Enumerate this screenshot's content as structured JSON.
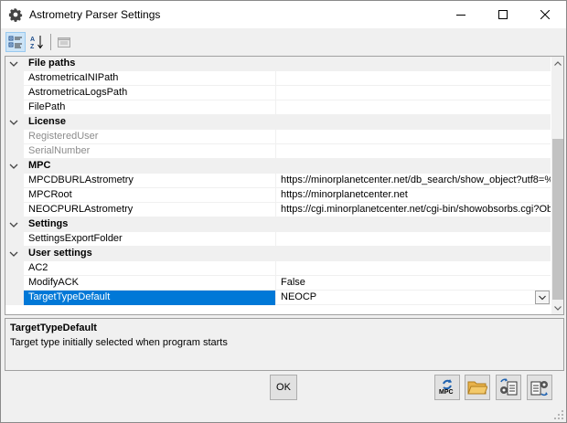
{
  "window": {
    "title": "Astrometry Parser Settings",
    "icon": "gear-icon"
  },
  "toolbar": {
    "categorized_icon": "categorized-view-icon",
    "alphabetical_icon": "sort-az-icon",
    "property_pages_icon": "property-pages-icon"
  },
  "grid": {
    "categories": [
      {
        "label": "File paths",
        "properties": [
          {
            "name": "AstrometricaINIPath",
            "value": ""
          },
          {
            "name": "AstrometricaLogsPath",
            "value": ""
          },
          {
            "name": "FilePath",
            "value": ""
          }
        ]
      },
      {
        "label": "License",
        "properties": [
          {
            "name": "RegisteredUser",
            "value": ""
          },
          {
            "name": "SerialNumber",
            "value": ""
          }
        ]
      },
      {
        "label": "MPC",
        "properties": [
          {
            "name": "MPCDBURLAstrometry",
            "value": "https://minorplanetcenter.net/db_search/show_object?utf8=%"
          },
          {
            "name": "MPCRoot",
            "value": "https://minorplanetcenter.net"
          },
          {
            "name": "NEOCPURLAstrometry",
            "value": "https://cgi.minorplanetcenter.net/cgi-bin/showobsorbs.cgi?Ob"
          }
        ]
      },
      {
        "label": "Settings",
        "properties": [
          {
            "name": "SettingsExportFolder",
            "value": ""
          }
        ]
      },
      {
        "label": "User settings",
        "properties": [
          {
            "name": "AC2",
            "value": ""
          },
          {
            "name": "ModifyACK",
            "value": "False"
          },
          {
            "name": "TargetTypeDefault",
            "value": "NEOCP"
          }
        ]
      }
    ]
  },
  "description": {
    "title": "TargetTypeDefault",
    "text": "Target type initially selected when program starts"
  },
  "buttons": {
    "ok_label": "OK",
    "mpc_label": "MPC"
  }
}
